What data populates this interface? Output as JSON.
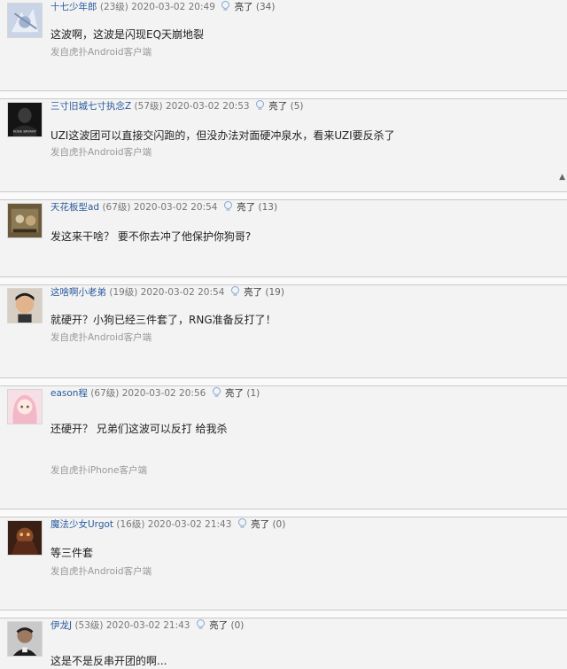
{
  "light_label": "亮了",
  "posts": [
    {
      "username": "十七少年郎",
      "level": "(23级)",
      "time": "2020-03-02 20:49",
      "count": "(34)",
      "content": "这波啊，这波是闪现EQ天崩地裂",
      "source": "发自虎扑Android客户端"
    },
    {
      "username": "三寸旧城七寸执念Z",
      "level": "(57级)",
      "time": "2020-03-02 20:53",
      "count": "(5)",
      "content": "UZI这波团可以直接交闪跑的，但没办法对面硬冲泉水，看来UZI要反杀了",
      "source": "发自虎扑Android客户端",
      "avatar_text": "KOBE BRYANT"
    },
    {
      "username": "天花板型ad",
      "level": "(67级)",
      "time": "2020-03-02 20:54",
      "count": "(13)",
      "content": "发这来干啥？ 要不你去冲了他保护你狗哥?",
      "source": ""
    },
    {
      "username": "这啥啊小老弟",
      "level": "(19级)",
      "time": "2020-03-02 20:54",
      "count": "(19)",
      "content": "就硬开？小狗已经三件套了，RNG准备反打了！",
      "source": "发自虎扑Android客户端"
    },
    {
      "username": "eason程",
      "level": "(67级)",
      "time": "2020-03-02 20:56",
      "count": "(1)",
      "content": "还硬开？ 兄弟们这波可以反打 给我杀",
      "source": "发自虎扑iPhone客户端"
    },
    {
      "username": "魔法少女Urgot",
      "level": "(16级)",
      "time": "2020-03-02 21:43",
      "count": "(0)",
      "content": "等三件套",
      "source": "发自虎扑Android客户端"
    },
    {
      "username": "伊龙J",
      "level": "(53级)",
      "time": "2020-03-02 21:43",
      "count": "(0)",
      "content": "这是不是反串开团的啊...",
      "source": ""
    }
  ]
}
